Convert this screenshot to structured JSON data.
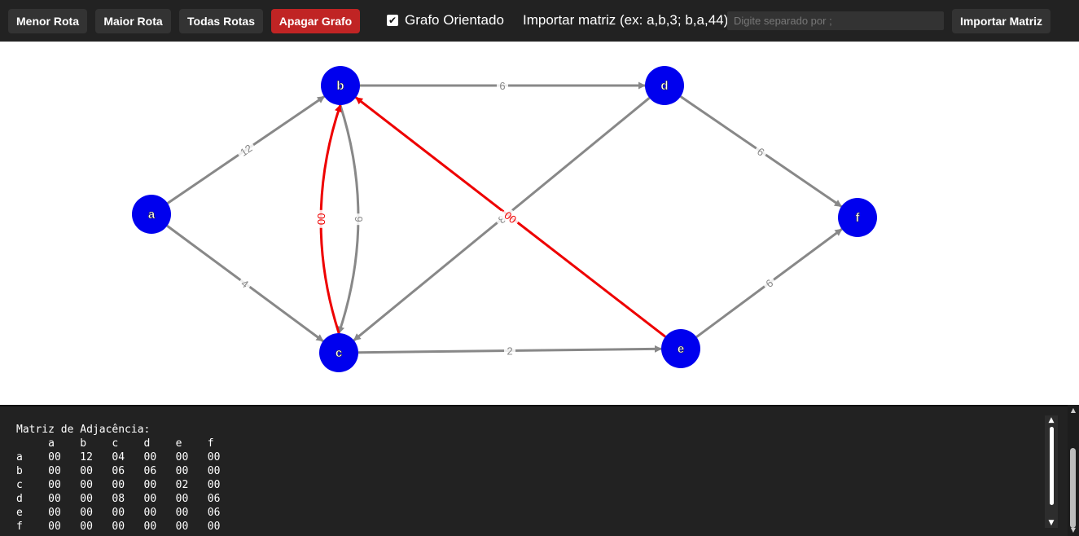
{
  "toolbar": {
    "shortest_route": "Menor Rota",
    "longest_route": "Maior Rota",
    "all_routes": "Todas Rotas",
    "clear_graph": "Apagar Grafo",
    "directed_checkbox": "✔",
    "directed_label": "Grafo Orientado",
    "import_label": "Importar matriz (ex: a,b,3; b,a,44):",
    "import_placeholder": "Digite separado por ;",
    "import_value": "",
    "import_button": "Importar Matriz"
  },
  "colors": {
    "node": "#0000ee",
    "edge": "#888888",
    "highlight": "#ee0000",
    "toolbar_bg": "#222222",
    "danger": "#c02424"
  },
  "graph": {
    "nodes": [
      "a",
      "b",
      "c",
      "d",
      "e",
      "f"
    ],
    "edges": [
      {
        "from": "a",
        "to": "b",
        "weight": "12",
        "highlight": false
      },
      {
        "from": "a",
        "to": "c",
        "weight": "4",
        "highlight": false
      },
      {
        "from": "b",
        "to": "c",
        "weight": "6",
        "highlight": false
      },
      {
        "from": "b",
        "to": "d",
        "weight": "6",
        "highlight": false
      },
      {
        "from": "c",
        "to": "e",
        "weight": "2",
        "highlight": false
      },
      {
        "from": "d",
        "to": "c",
        "weight": "8",
        "highlight": false
      },
      {
        "from": "d",
        "to": "f",
        "weight": "6",
        "highlight": false
      },
      {
        "from": "e",
        "to": "f",
        "weight": "6",
        "highlight": false
      },
      {
        "from": "c",
        "to": "b",
        "weight": "00",
        "highlight": true
      },
      {
        "from": "e",
        "to": "b",
        "weight": "00",
        "highlight": true
      }
    ]
  },
  "console": {
    "title": "Matriz de Adjacência:",
    "columns": [
      "a",
      "b",
      "c",
      "d",
      "e",
      "f"
    ],
    "rows": [
      {
        "label": "a",
        "values": [
          "00",
          "12",
          "04",
          "00",
          "00",
          "00"
        ]
      },
      {
        "label": "b",
        "values": [
          "00",
          "00",
          "06",
          "06",
          "00",
          "00"
        ]
      },
      {
        "label": "c",
        "values": [
          "00",
          "00",
          "00",
          "00",
          "02",
          "00"
        ]
      },
      {
        "label": "d",
        "values": [
          "00",
          "00",
          "08",
          "00",
          "00",
          "06"
        ]
      },
      {
        "label": "e",
        "values": [
          "00",
          "00",
          "00",
          "00",
          "00",
          "06"
        ]
      },
      {
        "label": "f",
        "values": [
          "00",
          "00",
          "00",
          "00",
          "00",
          "00"
        ]
      }
    ]
  },
  "scroll": {
    "up_icon": "▲",
    "down_icon": "▼"
  }
}
